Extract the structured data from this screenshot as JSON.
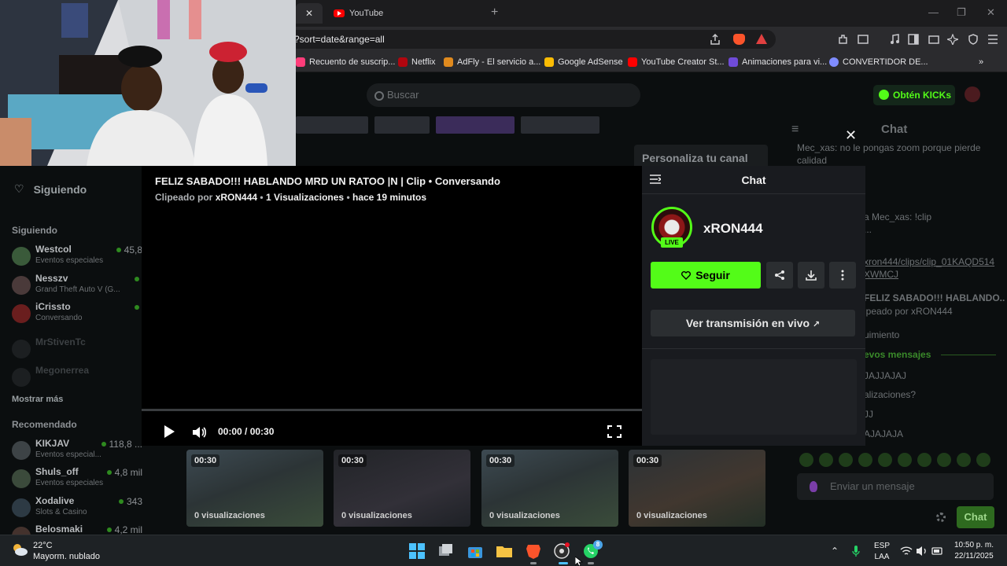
{
  "browser": {
    "tab_youtube": "YouTube",
    "url": "?sort=date&range=all",
    "bookmarks": [
      "Recuento de suscrip...",
      "Netflix",
      "AdFly - El servicio a...",
      "Google AdSense",
      "YouTube Creator St...",
      "Animaciones para vi...",
      "CONVERTIDOR DE..."
    ]
  },
  "kick": {
    "search_placeholder": "Buscar",
    "kicks_button": "Obtén KICKs",
    "personalize": "Personaliza tu canal",
    "sidebar": {
      "following_header": "Siguiendo",
      "following_section": "Siguiendo",
      "following": [
        {
          "name": "Westcol",
          "category": "Eventos especiales",
          "viewers": "45,8"
        },
        {
          "name": "Nesszv",
          "category": "Grand Theft Auto V (G...",
          "viewers": ""
        },
        {
          "name": "iCrissto",
          "category": "Conversando",
          "viewers": ""
        },
        {
          "name": "MrStivenTc",
          "category": "",
          "viewers": ""
        },
        {
          "name": "Megonerrea",
          "category": "",
          "viewers": ""
        }
      ],
      "show_more": "Mostrar más",
      "recommended_section": "Recomendado",
      "recommended": [
        {
          "name": "KIKJAV",
          "category": "Eventos especial...",
          "viewers": "118,8 ..."
        },
        {
          "name": "Shuls_off",
          "category": "Eventos especiales",
          "viewers": "4,8 mil"
        },
        {
          "name": "Xodalive",
          "category": "Slots & Casino",
          "viewers": "343"
        },
        {
          "name": "Belosmaki",
          "category": "",
          "viewers": "4,2 mil"
        }
      ]
    },
    "clips": [
      {
        "duration": "00:30",
        "views": "0 visualizaciones"
      },
      {
        "duration": "00:30",
        "views": "0 visualizaciones"
      },
      {
        "duration": "00:30",
        "views": "0 visualizaciones"
      },
      {
        "duration": "00:30",
        "views": "0 visualizaciones"
      }
    ],
    "bg_chat": {
      "title": "Chat",
      "messages": [
        "Mec_xas: no le pongas zoom porque pierde",
        "calidad",
        "a Mec_xas: !clip",
        "...",
        "xron444/clips/clip_01KAQD514",
        "XWMCJ",
        "FELIZ SABADO!!! HABLANDO..",
        "ipeado por xRON444",
        "uimiento",
        "JAJJAJAJ",
        "alizaciones?",
        "JJ",
        "AJAJAJA"
      ],
      "new_messages": "evos mensajes",
      "input_placeholder": "Enviar un mensaje",
      "send": "Chat"
    }
  },
  "modal": {
    "title": "FELIZ SABADO!!! HABLANDO MRD UN RATOO |N | Clip • Conversando",
    "clipped_by_label": "Clipeado por",
    "clipped_by": "xRON444",
    "views": "1 Visualizaciones",
    "ago": "hace 19 minutos",
    "time": "00:00 / 00:30",
    "progress": 0,
    "chat_title": "Chat",
    "streamer": "xRON444",
    "live": "LIVE",
    "follow": "Seguir",
    "watch_live": "Ver transmisión en vivo"
  },
  "taskbar": {
    "temperature": "22°C",
    "condition": "Mayorm. nublado",
    "whatsapp_badge": "8",
    "lang": "ESP",
    "layout": "LAA",
    "time": "10:50 p. m.",
    "date": "22/11/2025"
  }
}
